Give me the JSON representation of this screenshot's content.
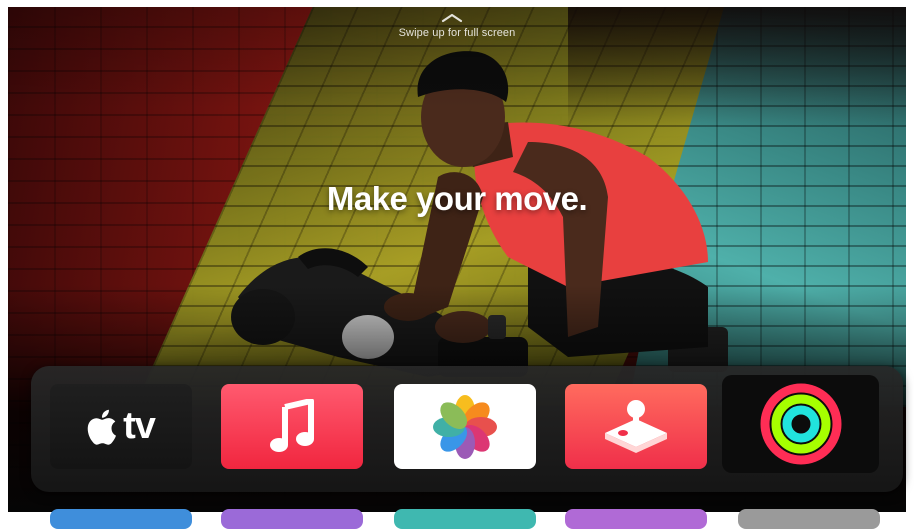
{
  "hero": {
    "swipe_hint": "Swipe up for full screen",
    "headline": "Make your move."
  },
  "dock": {
    "apps": [
      {
        "name": "TV",
        "label": "tv",
        "icon": "apple-logo-icon"
      },
      {
        "name": "Music",
        "icon": "music-note-icon",
        "color": "#f1263f"
      },
      {
        "name": "Photos",
        "icon": "photos-flower-icon"
      },
      {
        "name": "Arcade",
        "icon": "joystick-icon",
        "color": "#f02f4a"
      },
      {
        "name": "Fitness",
        "icon": "activity-rings-icon"
      }
    ],
    "second_row_colors": [
      "#3f8edb",
      "#9b6ad8",
      "#3fb8b0",
      "#b06ad6",
      "#9a9a9a"
    ]
  }
}
